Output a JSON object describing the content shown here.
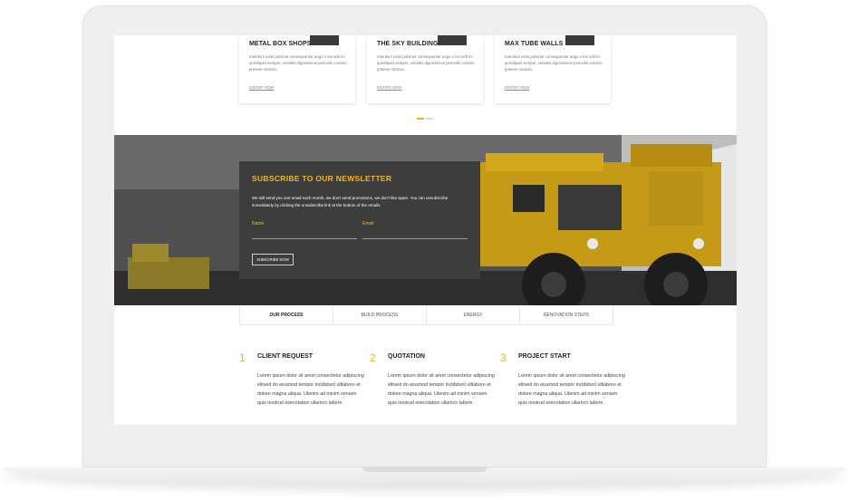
{
  "cards": [
    {
      "title": "METAL BOX SHOPS",
      "desc": "Interdum iusto pulvinar consequuntur augu s est odit mi quisiliquid semper, veritatis dignissimos pericello constro pretese mertoio.",
      "link": "ENTER NOW"
    },
    {
      "title": "THE SKY BUILDING",
      "desc": "Interdum iusto pulvinar consequuntur augu s est odit mi quisiliquid semper, veritatis dignissimos pericello constro pretese mertoio.",
      "link": "ENTER NOW"
    },
    {
      "title": "MAX TUBE WALLS",
      "desc": "Interdum iusto pulvinar consequuntur augu s est odit mi quisiliquid semper, veritatis dignissimos pericello constro pretese mertoio.",
      "link": "ENTER NOW"
    }
  ],
  "newsletter": {
    "title": "SUBSCRIBE TO OUR NEWSLETTER",
    "text": "We will send you one email each month, we don't send promotions, we don't like spam. You can unsubscribe immediately by clicking the unsubscribe link at the bottom of the emails.",
    "name_label": "Name",
    "email_label": "Email",
    "button": "SUBSCRIBE NOW"
  },
  "tabs": [
    "OUR PROCESS",
    "BUILD PROCESS",
    "ENERGY",
    "RENOVATION STEPS"
  ],
  "steps": [
    {
      "num": "1",
      "title": "CLIENT REQUEST",
      "text": "Lorem ipsum dolor sit amet consectetur adipiscing elitsed do eiusmod tempor incididunt ultlabore et dolore magna aliqua. Utenim ad minim veniam quis nostrud exercitation ullamco labore."
    },
    {
      "num": "2",
      "title": "QUOTATION",
      "text": "Lorem ipsum dolor sit amet consectetur adipiscing elitsed do eiusmod tempor incididunt ultlabore et dolore magna aliqua. Utenim ad minim veniam quis nostrud exercitation ullamco labore."
    },
    {
      "num": "3",
      "title": "PROJECT START",
      "text": "Lorem ipsum dolor sit amet consectetur adipiscing elitsed do eiusmod tempor incididunt ultlabore et dolore magna aliqua. Utenim ad minim veniam quis nostrud exercitation ullamco labore."
    }
  ],
  "colors": {
    "accent": "#f2b61b",
    "panel": "#3d3d3d"
  }
}
